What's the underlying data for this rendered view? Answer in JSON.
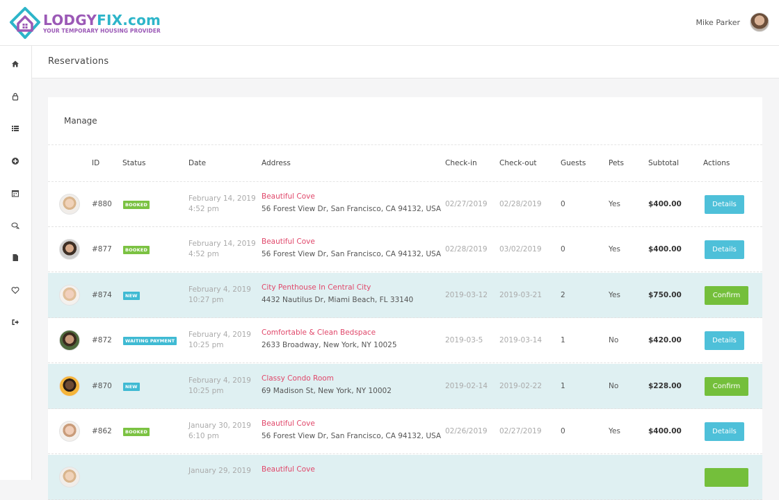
{
  "brand": {
    "title_a": "LODGY",
    "title_b": "FIX.com",
    "subtitle": "YOUR TEMPORARY HOUSING PROVIDER"
  },
  "user": {
    "name": "Mike Parker"
  },
  "sidebar": {
    "items": [
      {
        "icon": "home-icon"
      },
      {
        "icon": "lock-icon"
      },
      {
        "icon": "list-icon"
      },
      {
        "icon": "plus-circle-icon"
      },
      {
        "icon": "calendar-icon"
      },
      {
        "icon": "chat-icon"
      },
      {
        "icon": "file-icon"
      },
      {
        "icon": "heart-icon"
      },
      {
        "icon": "sign-out-icon"
      }
    ]
  },
  "page": {
    "title": "Reservations"
  },
  "card": {
    "title": "Manage"
  },
  "table": {
    "headers": {
      "id": "ID",
      "status": "Status",
      "date": "Date",
      "address": "Address",
      "checkin": "Check-in",
      "checkout": "Check-out",
      "guests": "Guests",
      "pets": "Pets",
      "subtotal": "Subtotal",
      "actions": "Actions"
    },
    "rows": [
      {
        "id": "#880",
        "status": "BOOKED",
        "date": "February 14, 2019",
        "time": "4:52 pm",
        "name": "Beautiful Cove",
        "address": "56 Forest View Dr, San Francisco, CA 94132, USA",
        "checkin": "02/27/2019",
        "checkout": "02/28/2019",
        "guests": "0",
        "pets": "Yes",
        "subtotal": "$400.00",
        "action": "Details"
      },
      {
        "id": "#877",
        "status": "BOOKED",
        "date": "February 14, 2019",
        "time": "4:52 pm",
        "name": "Beautiful Cove",
        "address": "56 Forest View Dr, San Francisco, CA 94132, USA",
        "checkin": "02/28/2019",
        "checkout": "03/02/2019",
        "guests": "0",
        "pets": "Yes",
        "subtotal": "$400.00",
        "action": "Details"
      },
      {
        "id": "#874",
        "status": "NEW",
        "date": "February 4, 2019",
        "time": "10:27 pm",
        "name": "City Penthouse In Central City",
        "address": "4432 Nautilus Dr, Miami Beach, FL 33140",
        "checkin": "2019-03-12",
        "checkout": "2019-03-21",
        "guests": "2",
        "pets": "Yes",
        "subtotal": "$750.00",
        "action": "Confirm"
      },
      {
        "id": "#872",
        "status": "WAITING PAYMENT",
        "date": "February 4, 2019",
        "time": "10:25 pm",
        "name": "Comfortable & Clean Bedspace",
        "address": "2633 Broadway, New York, NY 10025",
        "checkin": "2019-03-5",
        "checkout": "2019-03-14",
        "guests": "1",
        "pets": "No",
        "subtotal": "$420.00",
        "action": "Details"
      },
      {
        "id": "#870",
        "status": "NEW",
        "date": "February 4, 2019",
        "time": "10:25 pm",
        "name": "Classy Condo Room",
        "address": "69 Madison St, New York, NY 10002",
        "checkin": "2019-02-14",
        "checkout": "2019-02-22",
        "guests": "1",
        "pets": "No",
        "subtotal": "$228.00",
        "action": "Confirm"
      },
      {
        "id": "#862",
        "status": "BOOKED",
        "date": "January 30, 2019",
        "time": "6:10 pm",
        "name": "Beautiful Cove",
        "address": "56 Forest View Dr, San Francisco, CA 94132, USA",
        "checkin": "02/26/2019",
        "checkout": "02/27/2019",
        "guests": "0",
        "pets": "Yes",
        "subtotal": "$400.00",
        "action": "Details"
      },
      {
        "date": "January 29, 2019",
        "name": "Beautiful Cove"
      }
    ]
  }
}
